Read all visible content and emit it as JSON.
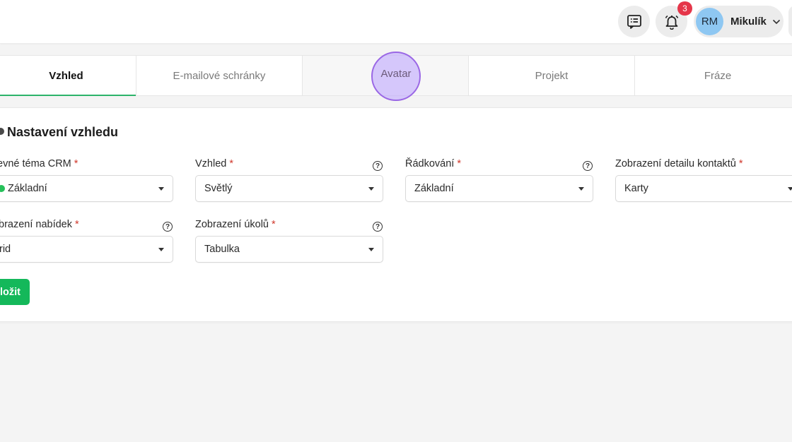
{
  "header": {
    "notification_count": "3",
    "user": {
      "initials": "RM",
      "name": "Mikulík"
    }
  },
  "tabs": [
    {
      "label": "Vzhled",
      "active": true
    },
    {
      "label": "E-mailové schránky",
      "active": false
    },
    {
      "label": "Avatar",
      "active": false
    },
    {
      "label": "Projekt",
      "active": false
    },
    {
      "label": "Fráze",
      "active": false
    }
  ],
  "section": {
    "title": "Nastavení vzhledu"
  },
  "fields": {
    "color_theme": {
      "label": "evné téma CRM",
      "value": "Základní",
      "required": "*"
    },
    "appearance": {
      "label": "Vzhled",
      "value": "Světlý",
      "required": "*"
    },
    "spacing": {
      "label": "Řádkování",
      "value": "Základní",
      "required": "*"
    },
    "contact_detail": {
      "label": "Zobrazení detailu kontaktů",
      "value": "Karty",
      "required": "*"
    },
    "offers_view": {
      "label": "brazení nabídek",
      "value": "rid",
      "required": "*"
    },
    "tasks_view": {
      "label": "Zobrazení úkolů",
      "value": "Tabulka",
      "required": "*"
    }
  },
  "help_glyph": "?",
  "save_button": "ložit",
  "colors": {
    "accent_green": "#14b85a",
    "active_tab_underline": "#2cb36a",
    "badge_red": "#e5364a",
    "avatar_blue": "#8ec7f2",
    "required_red": "#d0382c",
    "click_highlight": "#9a67e5"
  },
  "icons": {
    "chat": "chat-list-icon",
    "bell": "bell-icon",
    "chevron": "chevron-down-icon",
    "help": "question-circle-icon",
    "caret": "caret-down-icon"
  }
}
